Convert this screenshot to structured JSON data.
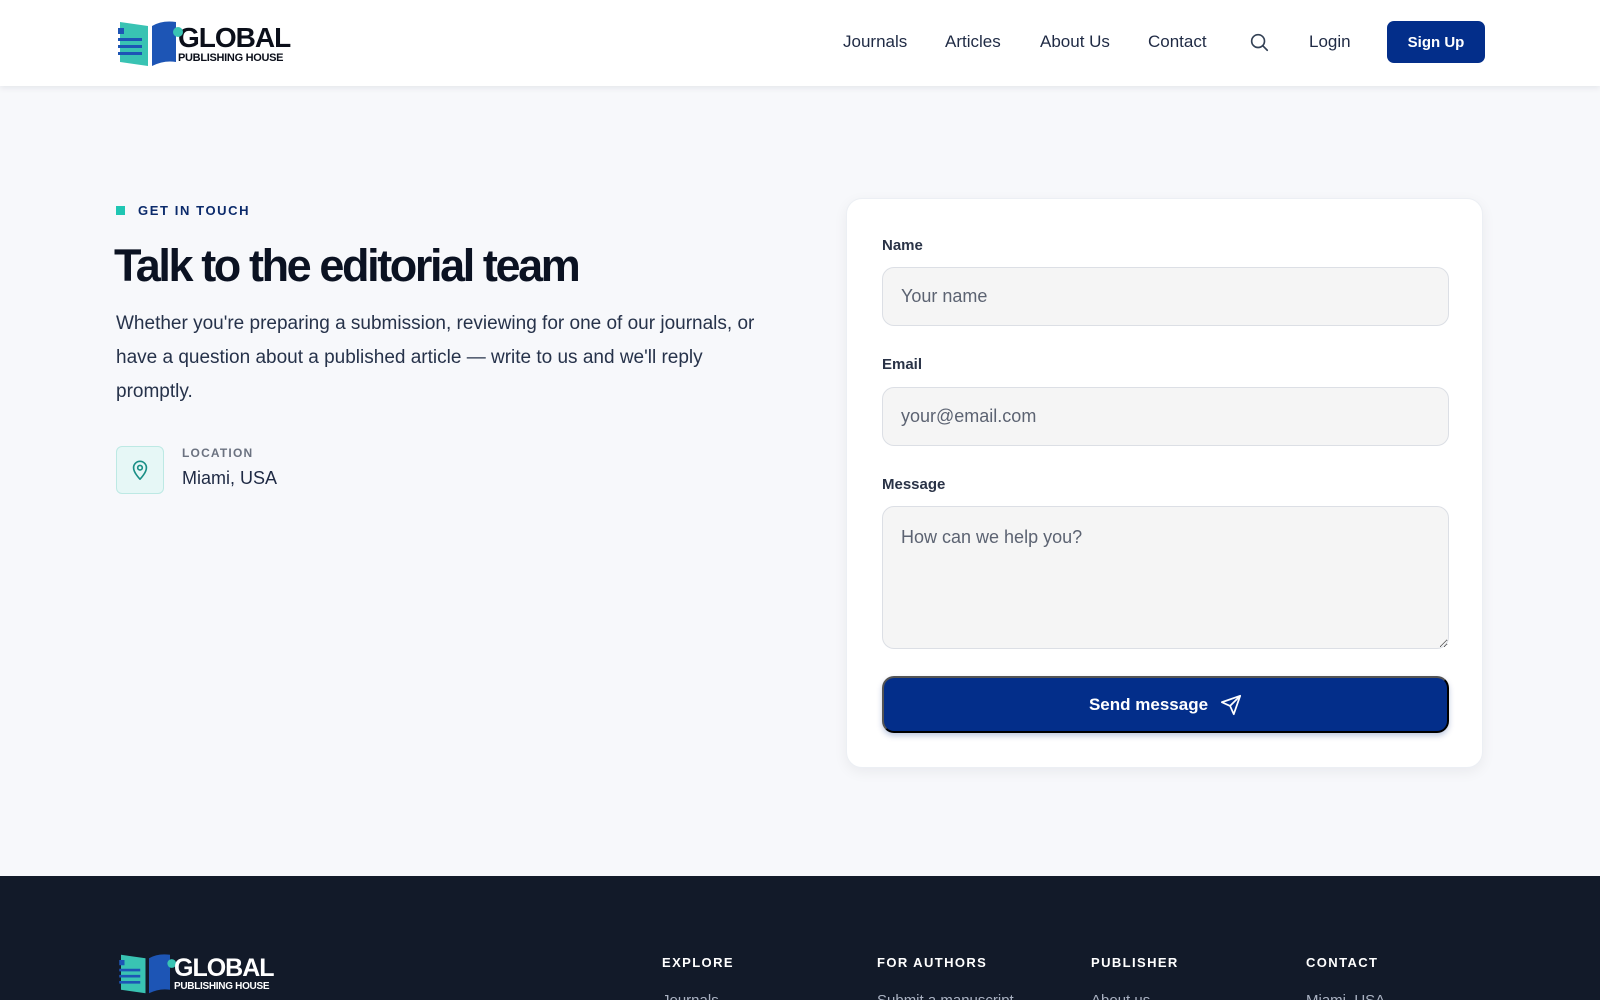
{
  "brand": {
    "name_line1": "GLOBAL",
    "name_line2": "PUBLISHING HOUSE",
    "colors": {
      "primary": "#032e8a",
      "accent": "#1fc6b3",
      "dark": "#121a29"
    }
  },
  "nav": {
    "links": [
      "Journals",
      "Articles",
      "About Us",
      "Contact"
    ],
    "search_icon": "search-icon",
    "login": "Login",
    "signup": "Sign Up"
  },
  "hero": {
    "eyebrow": "GET IN TOUCH",
    "title": "Talk to the editorial team",
    "lead": "Whether you're preparing a submission, reviewing for one of our journals, or have a question about a published article — write to us and we'll reply promptly.",
    "location_label": "LOCATION",
    "location_value": "Miami, USA",
    "location_icon": "map-pin-icon"
  },
  "form": {
    "name_label": "Name",
    "name_placeholder": "Your name",
    "email_label": "Email",
    "email_placeholder": "your@email.com",
    "message_label": "Message",
    "message_placeholder": "How can we help you?",
    "submit": "Send message",
    "submit_icon": "send-icon"
  },
  "footer": {
    "columns": [
      {
        "heading": "EXPLORE",
        "first_link": "Journals"
      },
      {
        "heading": "FOR AUTHORS",
        "first_link": "Submit a manuscript"
      },
      {
        "heading": "PUBLISHER",
        "first_link": "About us"
      },
      {
        "heading": "CONTACT",
        "first_link": "Miami, USA"
      }
    ]
  }
}
